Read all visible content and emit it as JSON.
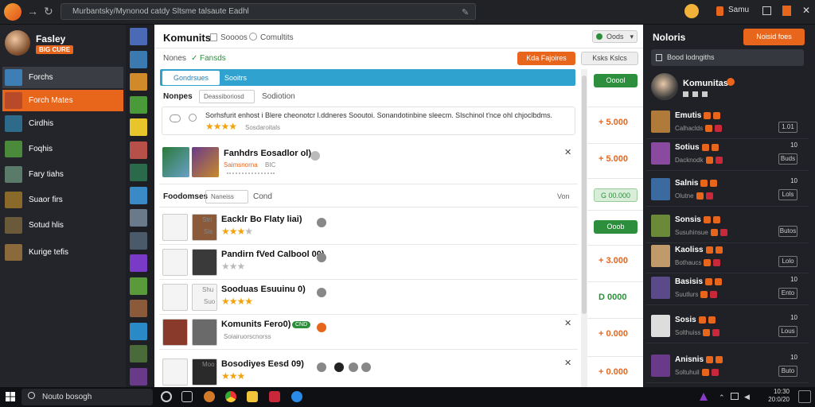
{
  "browser": {
    "address": "Murbantsky/Mynonod catdy Sltsme talsaute Eadhl",
    "right_label": "Samu"
  },
  "sidebar": {
    "profile_name": "Fasley",
    "profile_badge": "BIG CURE",
    "items": [
      {
        "label": "Forchs",
        "thumb": "#3d7eb5"
      },
      {
        "label": "Forch Mates",
        "thumb": "#b84a2a"
      },
      {
        "label": "Cirdhis",
        "thumb": "#2e6a8a"
      },
      {
        "label": "Foqhis",
        "thumb": "#4a8a3a"
      },
      {
        "label": "Fary tiahs",
        "thumb": "#5a7a6a"
      },
      {
        "label": "Suaor firs",
        "thumb": "#8a6a2a"
      },
      {
        "label": "Sotud hlis",
        "thumb": "#6a5a3a"
      },
      {
        "label": "Kurige tefis",
        "thumb": "#8a6a3a"
      }
    ]
  },
  "strip": [
    "#4a6ab5",
    "#3a7ab0",
    "#d08a2a",
    "#4a9a3a",
    "#e6c62a",
    "#b8504a",
    "#2a6a4a",
    "#3a8ac8",
    "#6a7a8a",
    "#4a5a6a",
    "#7a3ac8",
    "#5a9a3a",
    "#8a5a3a",
    "#2a8ac8",
    "#4a6a3a",
    "#6a3a8a"
  ],
  "main": {
    "title": "Komunits",
    "title_tab": "Soooos",
    "title_tab2": "Comultits",
    "top_right_btn": "Oods",
    "names_label": "Nones",
    "names_tag": "Fansds",
    "btn_orange": "Kda Fajoires",
    "btn_grey": "Ksks Kslcs",
    "tab_active": "Gondrsues",
    "tab_2": "Sooitrs",
    "nonnes_label": "Nonpes",
    "nonnes_field": "Deassiboriosd",
    "nonnes_link": "Sodiotion",
    "banner_text": "Sorhsfurit enhost i Blere cheonotcr l.ddneres Sooutoi. Sonandotinbine sleecm. Slschinol t'nce ohl chjoclbdms.",
    "banner_sub": "Sosdaroitals",
    "banner_stars": "★★★★",
    "feature_title": "Fanhdrs Eosadlor ol)",
    "feature_sub": "Saimsnorna",
    "feature_sub2": "BIC",
    "filter_label": "Foodomses",
    "filter_field": "Naneiss",
    "filter_link": "Cond",
    "filter_more": "Von",
    "rows": [
      {
        "title": "Eacklr Bo Flaty liai)",
        "pre": "Stri",
        "sub": "Sis",
        "stars": "★★★",
        "gstars": "★",
        "dots": [
          "Ol"
        ]
      },
      {
        "title": "Pandirn fVed Calbool 00)",
        "pre": "",
        "sub": "",
        "stars": "",
        "gstars": "★★★",
        "dots": []
      },
      {
        "title": "Sooduas Esuuinu 0)",
        "pre": "Shu",
        "sub": "Suo",
        "stars": "★★★★",
        "gstars": "",
        "dots": [
          "Ol"
        ]
      },
      {
        "title": "Komunits Fero0)",
        "pre": "",
        "sub": "Soiairuorscnorss",
        "stars": "",
        "gstars": "",
        "dots": [
          "Ol"
        ],
        "badge": "CND"
      },
      {
        "title": "Bosodiyes Eesd 09)",
        "pre": "Moo",
        "sub": "",
        "stars": "★★★",
        "gstars": "",
        "dots": [
          "Ol",
          "Ol",
          "Ol"
        ]
      }
    ]
  },
  "prices": [
    {
      "label": "Ooool",
      "type": "green-btn"
    },
    {
      "label": "+ 5.000",
      "type": "text"
    },
    {
      "label": "+ 5.000",
      "type": "text"
    },
    {
      "label": "G 00.000",
      "type": "light-btn"
    },
    {
      "label": "Ooob",
      "type": "green-btn"
    },
    {
      "label": "+ 3.000",
      "type": "text"
    },
    {
      "label": "D 0000",
      "type": "greentext"
    },
    {
      "label": "+ 0.000",
      "type": "text"
    },
    {
      "label": "+ 0.000",
      "type": "text"
    }
  ],
  "right": {
    "title": "Noloris",
    "btn": "Noisid foes",
    "search": "Bood lodngiths",
    "top_name": "Komunitas",
    "friends": [
      {
        "name": "Emutis",
        "line": "Calhaclds",
        "count": "",
        "box": "1.01",
        "color": "#b07a3a"
      },
      {
        "name": "Sotius",
        "line": "Dacknodk",
        "count": "10",
        "box": "Buds",
        "color": "#8a4aa0"
      },
      {
        "name": "Salnis",
        "line": "Olutne",
        "count": "10",
        "box": "Lols",
        "color": "#3a6aa0"
      },
      {
        "name": "Sonsis",
        "line": "Susuhinsue",
        "count": "",
        "box": "Butos",
        "color": "#6a8a3a"
      },
      {
        "name": "Kaoliss",
        "line": "Bothaucs",
        "count": "",
        "box": "Lolo",
        "color": "#c09a6a"
      },
      {
        "name": "Basisis",
        "line": "Suutlurs",
        "count": "10",
        "box": "Ento",
        "color": "#5a4a8a"
      },
      {
        "name": "Sosis",
        "line": "Solthuiss",
        "count": "10",
        "box": "Lous",
        "color": "#dddddd"
      },
      {
        "name": "Anisnis",
        "line": "Soltuhuil",
        "count": "10",
        "box": "Buto",
        "color": "#6a3a8a"
      }
    ]
  },
  "taskbar": {
    "search": "Nouto bosogh",
    "time": "10:30",
    "date": "20:0/20"
  }
}
